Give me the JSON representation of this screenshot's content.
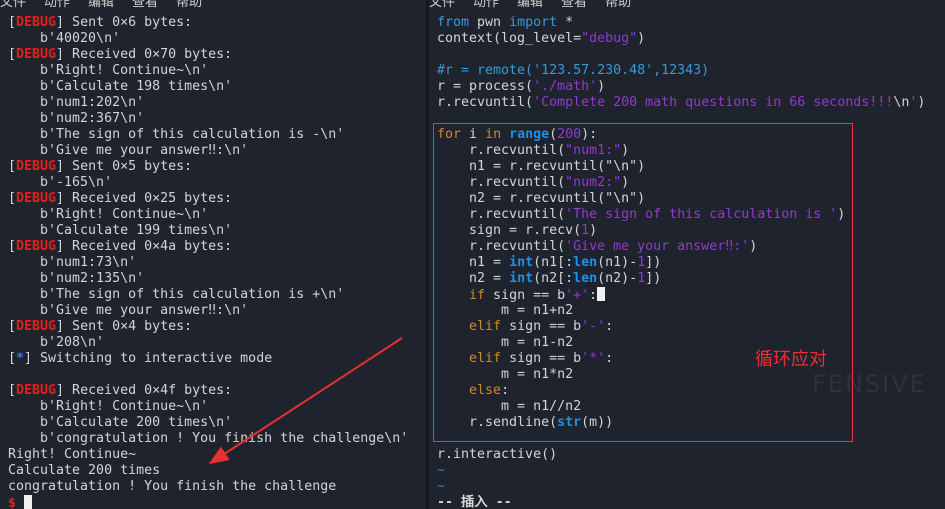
{
  "left_terminal": {
    "menu": [
      "文件",
      "动作",
      "编辑",
      "查看",
      "帮助"
    ],
    "lines": [
      [
        {
          "t": "["
        },
        {
          "t": "DEBUG",
          "k": "debug"
        },
        {
          "t": "] Sent 0×6 bytes:"
        }
      ],
      [
        {
          "t": "    b'40020\\n'"
        }
      ],
      [
        {
          "t": "["
        },
        {
          "t": "DEBUG",
          "k": "debug"
        },
        {
          "t": "] Received 0×70 bytes:"
        }
      ],
      [
        {
          "t": "    b'Right! Continue~\\n'"
        }
      ],
      [
        {
          "t": "    b'Calculate 198 times\\n'"
        }
      ],
      [
        {
          "t": "    b'num1:202\\n'"
        }
      ],
      [
        {
          "t": "    b'num2:367\\n'"
        }
      ],
      [
        {
          "t": "    b'The sign of this calculation is -\\n'"
        }
      ],
      [
        {
          "t": "    b'Give me your answer‼:\\n'"
        }
      ],
      [
        {
          "t": "["
        },
        {
          "t": "DEBUG",
          "k": "debug"
        },
        {
          "t": "] Sent 0×5 bytes:"
        }
      ],
      [
        {
          "t": "    b'-165\\n'"
        }
      ],
      [
        {
          "t": "["
        },
        {
          "t": "DEBUG",
          "k": "debug"
        },
        {
          "t": "] Received 0×25 bytes:"
        }
      ],
      [
        {
          "t": "    b'Right! Continue~\\n'"
        }
      ],
      [
        {
          "t": "    b'Calculate 199 times\\n'"
        }
      ],
      [
        {
          "t": "["
        },
        {
          "t": "DEBUG",
          "k": "debug"
        },
        {
          "t": "] Received 0×4a bytes:"
        }
      ],
      [
        {
          "t": "    b'num1:73\\n'"
        }
      ],
      [
        {
          "t": "    b'num2:135\\n'"
        }
      ],
      [
        {
          "t": "    b'The sign of this calculation is +\\n'"
        }
      ],
      [
        {
          "t": "    b'Give me your answer‼:\\n'"
        }
      ],
      [
        {
          "t": "["
        },
        {
          "t": "DEBUG",
          "k": "debug"
        },
        {
          "t": "] Sent 0×4 bytes:"
        }
      ],
      [
        {
          "t": "    b'208\\n'"
        }
      ],
      [
        {
          "t": "["
        },
        {
          "t": "*",
          "k": "info"
        },
        {
          "t": "] Switching to interactive mode"
        }
      ],
      [],
      [
        {
          "t": "["
        },
        {
          "t": "DEBUG",
          "k": "debug"
        },
        {
          "t": "] Received 0×4f bytes:"
        }
      ],
      [
        {
          "t": "    b'Right! Continue~\\n'"
        }
      ],
      [
        {
          "t": "    b'Calculate 200 times\\n'"
        }
      ],
      [
        {
          "t": "    b'congratulation ! You finish the challenge\\n'"
        }
      ],
      [
        {
          "t": "Right! Continue~"
        }
      ],
      [
        {
          "t": "Calculate 200 times"
        }
      ],
      [
        {
          "t": "congratulation ! You finish the challenge"
        }
      ],
      [
        {
          "t": "$",
          "k": "prompt"
        },
        {
          "t": " "
        },
        {
          "k": "cursor"
        }
      ]
    ]
  },
  "right_editor": {
    "menu": [
      "文件",
      "动作",
      "编辑",
      "查看",
      "帮助"
    ],
    "lines": [
      [
        {
          "t": "from",
          "k": "imp"
        },
        {
          "t": " pwn "
        },
        {
          "t": "import",
          "k": "imp"
        },
        {
          "t": " *"
        }
      ],
      [
        {
          "t": "context(log_level="
        },
        {
          "t": "\"debug\"",
          "k": "str"
        },
        {
          "t": ")"
        }
      ],
      [],
      [
        {
          "t": "#r = remote('123.57.230.48',12343)",
          "k": "cmt"
        }
      ],
      [
        {
          "t": "r = process("
        },
        {
          "t": "'./math'",
          "k": "str"
        },
        {
          "t": ")"
        }
      ],
      [
        {
          "t": "r.recvuntil("
        },
        {
          "t": "'Complete 200 math questions in 66 seconds!!!",
          "k": "str"
        },
        {
          "t": "\\n"
        },
        {
          "t": "'",
          "k": "str"
        },
        {
          "t": ")"
        }
      ],
      [],
      [
        {
          "t": "for",
          "k": "kw"
        },
        {
          "t": " i "
        },
        {
          "t": "in",
          "k": "kw"
        },
        {
          "t": " "
        },
        {
          "t": "range",
          "k": "bi"
        },
        {
          "t": "("
        },
        {
          "t": "200",
          "k": "num"
        },
        {
          "t": "):"
        }
      ],
      [
        {
          "t": "    r.recvuntil("
        },
        {
          "t": "\"num1:\"",
          "k": "str"
        },
        {
          "t": ")"
        }
      ],
      [
        {
          "t": "    n1 = r.recvuntil(\"\\n\")"
        }
      ],
      [
        {
          "t": "    r.recvuntil("
        },
        {
          "t": "\"num2:\"",
          "k": "str"
        },
        {
          "t": ")"
        }
      ],
      [
        {
          "t": "    n2 = r.recvuntil(\"\\n\")"
        }
      ],
      [
        {
          "t": "    r.recvuntil("
        },
        {
          "t": "'The sign of this calculation is '",
          "k": "str"
        },
        {
          "t": ")"
        }
      ],
      [
        {
          "t": "    sign = r.recv("
        },
        {
          "t": "1",
          "k": "num"
        },
        {
          "t": ")"
        }
      ],
      [
        {
          "t": "    r.recvuntil("
        },
        {
          "t": "'Give me your answer‼:'",
          "k": "str"
        },
        {
          "t": ")"
        }
      ],
      [
        {
          "t": "    n1 = "
        },
        {
          "t": "int",
          "k": "bi"
        },
        {
          "t": "(n1[:"
        },
        {
          "t": "len",
          "k": "bi"
        },
        {
          "t": "(n1)-"
        },
        {
          "t": "1",
          "k": "num"
        },
        {
          "t": "])"
        }
      ],
      [
        {
          "t": "    n2 = "
        },
        {
          "t": "int",
          "k": "bi"
        },
        {
          "t": "(n2[:"
        },
        {
          "t": "len",
          "k": "bi"
        },
        {
          "t": "(n2)-"
        },
        {
          "t": "1",
          "k": "num"
        },
        {
          "t": "])"
        }
      ],
      [
        {
          "t": "    "
        },
        {
          "t": "if",
          "k": "kw"
        },
        {
          "t": " sign == b"
        },
        {
          "t": "'+'",
          "k": "str"
        },
        {
          "t": ":"
        },
        {
          "k": "cursor"
        }
      ],
      [
        {
          "t": "        m = n1+n2"
        }
      ],
      [
        {
          "t": "    "
        },
        {
          "t": "elif",
          "k": "kw"
        },
        {
          "t": " sign == b"
        },
        {
          "t": "'-'",
          "k": "str"
        },
        {
          "t": ":"
        }
      ],
      [
        {
          "t": "        m = n1-n2"
        }
      ],
      [
        {
          "t": "    "
        },
        {
          "t": "elif",
          "k": "kw"
        },
        {
          "t": " sign == b"
        },
        {
          "t": "'*'",
          "k": "str"
        },
        {
          "t": ":"
        }
      ],
      [
        {
          "t": "        m = n1*n2"
        }
      ],
      [
        {
          "t": "    "
        },
        {
          "t": "else",
          "k": "kw"
        },
        {
          "t": ":"
        }
      ],
      [
        {
          "t": "        m = n1//n2"
        }
      ],
      [
        {
          "t": "    r.sendline("
        },
        {
          "t": "str",
          "k": "bi"
        },
        {
          "t": "(m))"
        }
      ],
      [],
      [
        {
          "t": "r.interactive()"
        }
      ],
      [
        {
          "t": "~",
          "k": "tilde"
        }
      ],
      [
        {
          "t": "~",
          "k": "tilde"
        }
      ],
      [
        {
          "t": "-- 插入 --",
          "k": "mode"
        }
      ]
    ]
  },
  "annotation": {
    "label": "循环应对",
    "color": "#e8312e"
  },
  "watermark": "FENSIVE",
  "colors": {
    "background": "#1f232d",
    "debug": "#e5201c",
    "keyword": "#c98a2c",
    "builtin": "#1e90e8",
    "string": "#8d3ccd",
    "annotation": "#e03a3a"
  }
}
